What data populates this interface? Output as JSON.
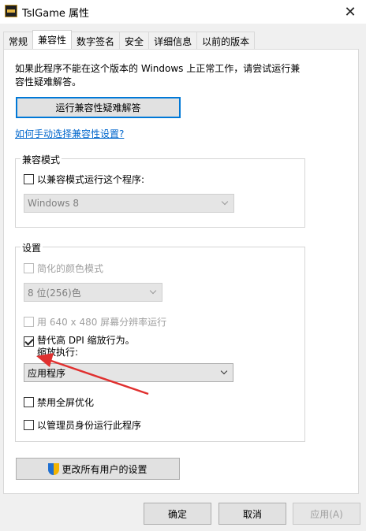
{
  "window": {
    "title": "TslGame 属性",
    "close_glyph": "✕"
  },
  "tabs": [
    {
      "label": "常规"
    },
    {
      "label": "兼容性"
    },
    {
      "label": "数字签名"
    },
    {
      "label": "安全"
    },
    {
      "label": "详细信息"
    },
    {
      "label": "以前的版本"
    }
  ],
  "compat": {
    "description": "如果此程序不能在这个版本的 Windows 上正常工作，请尝试运行兼容性疑难解答。",
    "troubleshoot_button": "运行兼容性疑难解答",
    "manual_link": "如何手动选择兼容性设置?",
    "mode_group": {
      "title": "兼容模式",
      "checkbox_label": "以兼容模式运行这个程序:",
      "os_select": "Windows 8"
    },
    "settings_group": {
      "title": "设置",
      "reduced_color": "简化的颜色模式",
      "color_select": "8 位(256)色",
      "run_640": "用 640 x 480 屏幕分辨率运行",
      "dpi_override": "替代高 DPI 缩放行为。",
      "scaling_label": "缩放执行:",
      "scaling_select": "应用程序",
      "disable_fullscreen": "禁用全屏优化",
      "run_admin": "以管理员身份运行此程序"
    },
    "all_users_button": "更改所有用户的设置"
  },
  "footer": {
    "ok": "确定",
    "cancel": "取消",
    "apply": "应用(A)"
  },
  "colors": {
    "accent": "#0078d7",
    "link": "#0066cc",
    "annotation_arrow": "#e0302f"
  }
}
